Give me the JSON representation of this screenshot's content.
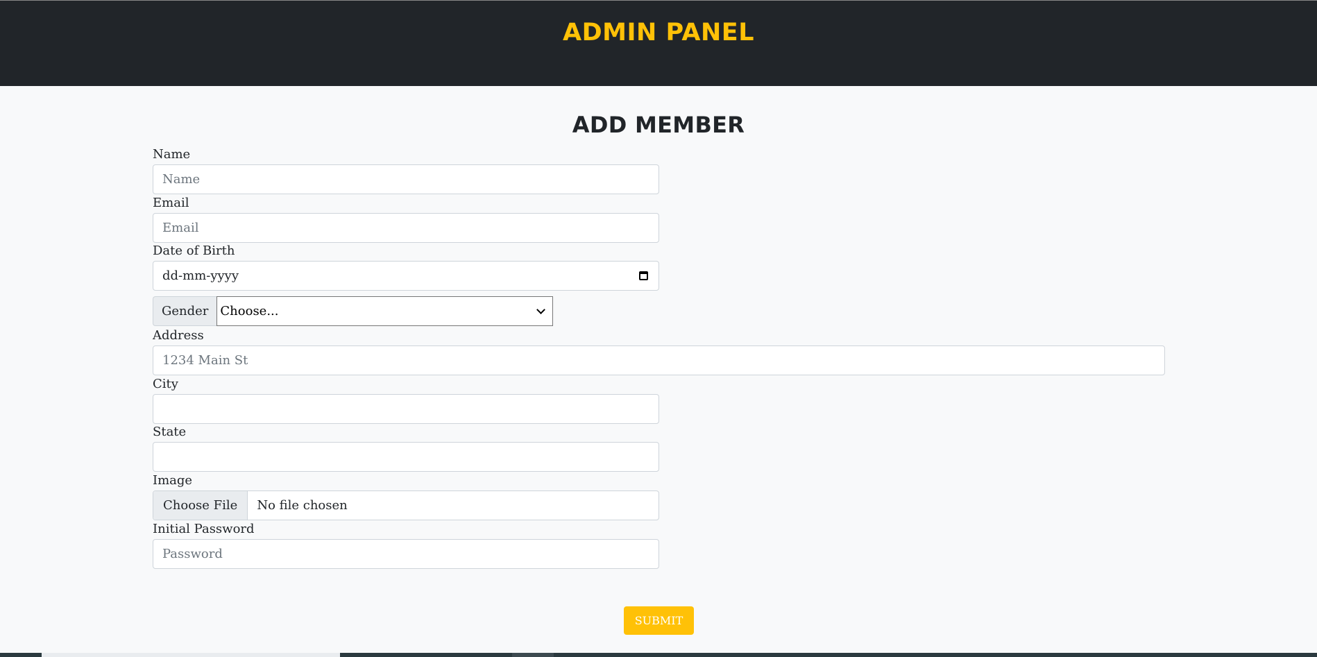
{
  "header": {
    "brand": "ADMIN PANEL"
  },
  "page": {
    "title": "ADD MEMBER"
  },
  "form": {
    "name": {
      "label": "Name",
      "placeholder": "Name"
    },
    "email": {
      "label": "Email",
      "placeholder": "Email"
    },
    "dob": {
      "label": "Date of Birth",
      "value": "dd-mm-yyyy"
    },
    "gender": {
      "label": "Gender",
      "selected": "Choose..."
    },
    "address": {
      "label": "Address",
      "placeholder": "1234 Main St"
    },
    "city": {
      "label": "City"
    },
    "state": {
      "label": "State"
    },
    "image": {
      "label": "Image",
      "button": "Choose File",
      "status": "No file chosen"
    },
    "password": {
      "label": "Initial Password",
      "placeholder": "Password"
    },
    "submit": "SUBMIT"
  },
  "colors": {
    "header_bg": "#212529",
    "accent": "#ffc107",
    "page_bg": "#f8f9fa"
  },
  "icons": {
    "date": "calendar-icon",
    "select": "chevron-down-icon"
  }
}
